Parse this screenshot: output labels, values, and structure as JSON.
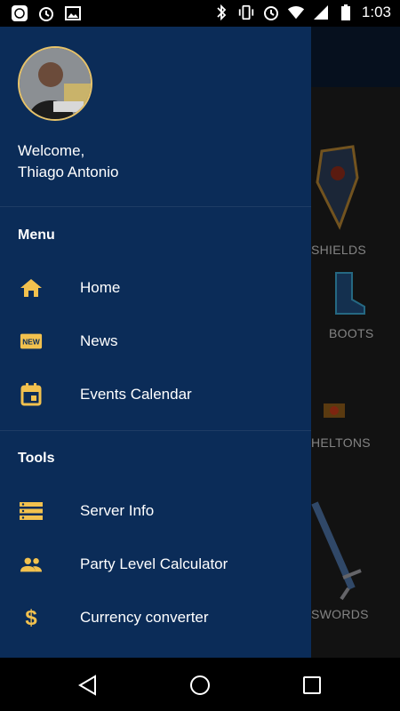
{
  "status_bar": {
    "time": "1:03",
    "icons_left": [
      "app-notification-icon",
      "alarm-icon",
      "image-icon"
    ],
    "icons_right": [
      "bluetooth-icon",
      "vibrate-icon",
      "alarm-icon",
      "wifi-icon",
      "signal-icon",
      "battery-icon"
    ]
  },
  "background_app": {
    "categories": [
      "SHIELDS",
      "BOOTS",
      "HELTONS",
      "SWORDS"
    ]
  },
  "drawer": {
    "welcome": "Welcome,",
    "username": "Thiago Antonio",
    "sections": [
      {
        "title": "Menu",
        "items": [
          {
            "label": "Home",
            "icon": "home-icon"
          },
          {
            "label": "News",
            "icon": "new-badge-icon"
          },
          {
            "label": "Events Calendar",
            "icon": "calendar-icon"
          }
        ]
      },
      {
        "title": "Tools",
        "items": [
          {
            "label": "Server Info",
            "icon": "server-icon"
          },
          {
            "label": "Party Level Calculator",
            "icon": "group-icon"
          },
          {
            "label": "Currency converter",
            "icon": "dollar-icon"
          }
        ]
      }
    ],
    "accent_color": "#f2c14e",
    "background_color": "#0b2c58"
  },
  "nav_bar": {
    "buttons": [
      "back-button",
      "home-button",
      "recents-button"
    ]
  }
}
